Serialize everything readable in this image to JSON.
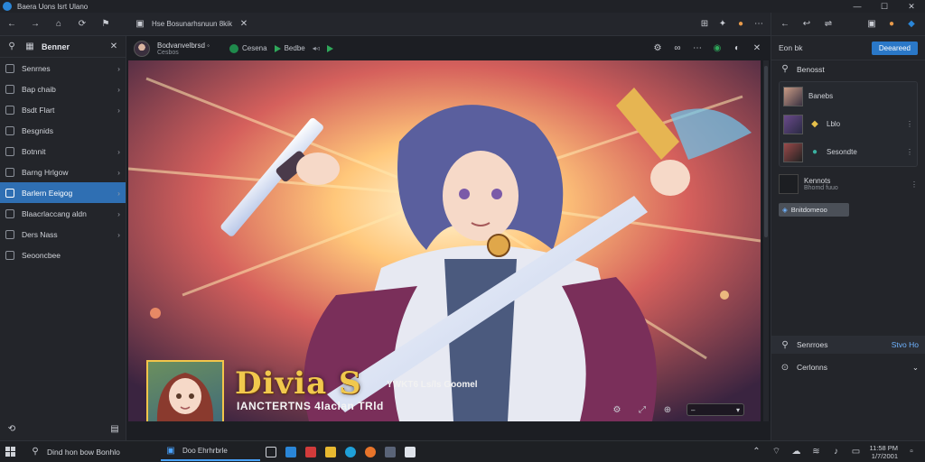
{
  "titlebar": {
    "title": "Baera Uons lsrt Ulano",
    "min": "—",
    "max": "☐",
    "close": "✕"
  },
  "tabstrip": {
    "tab_label": "Hse Bosunarhsnuun 8kik"
  },
  "sidebar": {
    "header": "Benner",
    "items": [
      {
        "label": "Senrnes",
        "has_chevron": true,
        "active": false
      },
      {
        "label": "Bap chaib",
        "has_chevron": true,
        "active": false
      },
      {
        "label": "Bsdt Flart",
        "has_chevron": true,
        "active": false
      },
      {
        "label": "Besgnids",
        "has_chevron": false,
        "active": false
      },
      {
        "label": "Botnnit",
        "has_chevron": true,
        "active": false
      },
      {
        "label": "Barng Hrlgow",
        "has_chevron": true,
        "active": false
      },
      {
        "label": "Barlern Eeigog",
        "has_chevron": true,
        "active": true
      },
      {
        "label": "Blaacrlaccang aldn",
        "has_chevron": true,
        "active": false
      },
      {
        "label": "Ders Nass",
        "has_chevron": true,
        "active": false
      },
      {
        "label": "Seooncbee",
        "has_chevron": false,
        "active": false
      }
    ]
  },
  "viewer": {
    "user_name": "Bodvanvelbrsd ◦",
    "user_sub": "Cesbos",
    "pill1": "Cesena",
    "pill2": "Bedbe",
    "extra": "◂◃"
  },
  "artwork": {
    "title": "Divia S",
    "tag": "YWKT6 Ls/ls Goomel",
    "subtitle": "IANCTERTNS 4laclan TRld"
  },
  "rightpanel": {
    "head_label": "Eon bk",
    "head_button": "Deeareed",
    "section_label": "Benosst",
    "cards": [
      {
        "label": "Banebs"
      },
      {
        "label": "Lblo"
      },
      {
        "label": "Sesondte"
      }
    ],
    "row2_label": "Kennots",
    "row2_sub": "Bhomd fuuo",
    "badge": "Bnitdomeoo",
    "foot1_label": "Senrroes",
    "foot1_accent": "Stvo Ho",
    "foot2_label": "Cerlonns"
  },
  "taskbar": {
    "search_text": "Dind hon bow Bonhlo",
    "active_app": "Doo Ehrhrbrle",
    "clock_time": "11:58 PM",
    "clock_date": "1/7/2001"
  },
  "colors": {
    "accent": "#2a78c8",
    "active_sidebar": "#2f6fb3",
    "title_gold": "#f1c84d"
  }
}
